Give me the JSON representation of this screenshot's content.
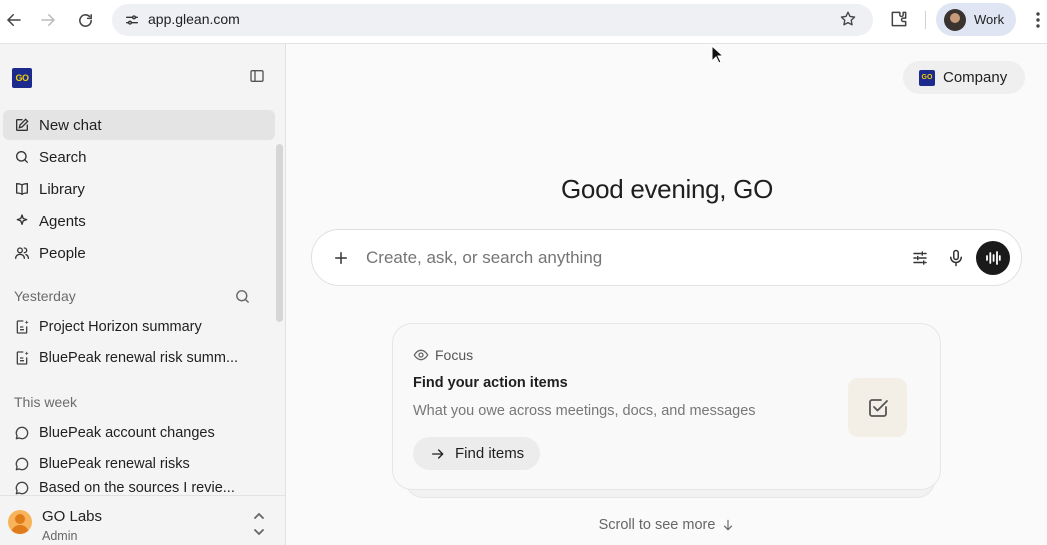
{
  "browser": {
    "url": "app.glean.com",
    "profile_label": "Work"
  },
  "sidebar": {
    "logo_text": "GO",
    "nav": [
      {
        "label": "New chat",
        "icon": "edit-icon",
        "active": true
      },
      {
        "label": "Search",
        "icon": "search-icon"
      },
      {
        "label": "Library",
        "icon": "book-icon"
      },
      {
        "label": "Agents",
        "icon": "agents-icon"
      },
      {
        "label": "People",
        "icon": "people-icon"
      }
    ],
    "sections": [
      {
        "label": "Yesterday",
        "items": [
          {
            "label": "Project Horizon summary",
            "icon": "document-sparkle-icon"
          },
          {
            "label": "BluePeak renewal risk summ...",
            "icon": "document-sparkle-icon"
          }
        ]
      },
      {
        "label": "This week",
        "items": [
          {
            "label": "BluePeak account changes",
            "icon": "chat-bubble-icon"
          },
          {
            "label": "BluePeak renewal risks",
            "icon": "chat-bubble-icon"
          },
          {
            "label": "Based on the sources I revie...",
            "icon": "chat-bubble-icon"
          }
        ]
      }
    ],
    "footer": {
      "org_name": "GO Labs",
      "role": "Admin"
    }
  },
  "main": {
    "company_button": "Company",
    "company_logo_text": "GO",
    "greeting": "Good evening, GO",
    "composer": {
      "placeholder": "Create, ask, or search anything"
    },
    "focus_card": {
      "tag": "Focus",
      "title": "Find your action items",
      "description": "What you owe across meetings, docs, and messages",
      "button": "Find items"
    },
    "scroll_hint": "Scroll to see more"
  },
  "colors": {
    "brand_logo_bg": "#1b2a8c",
    "brand_logo_text": "#f5d000",
    "voice_button": "#1a1a1a"
  }
}
